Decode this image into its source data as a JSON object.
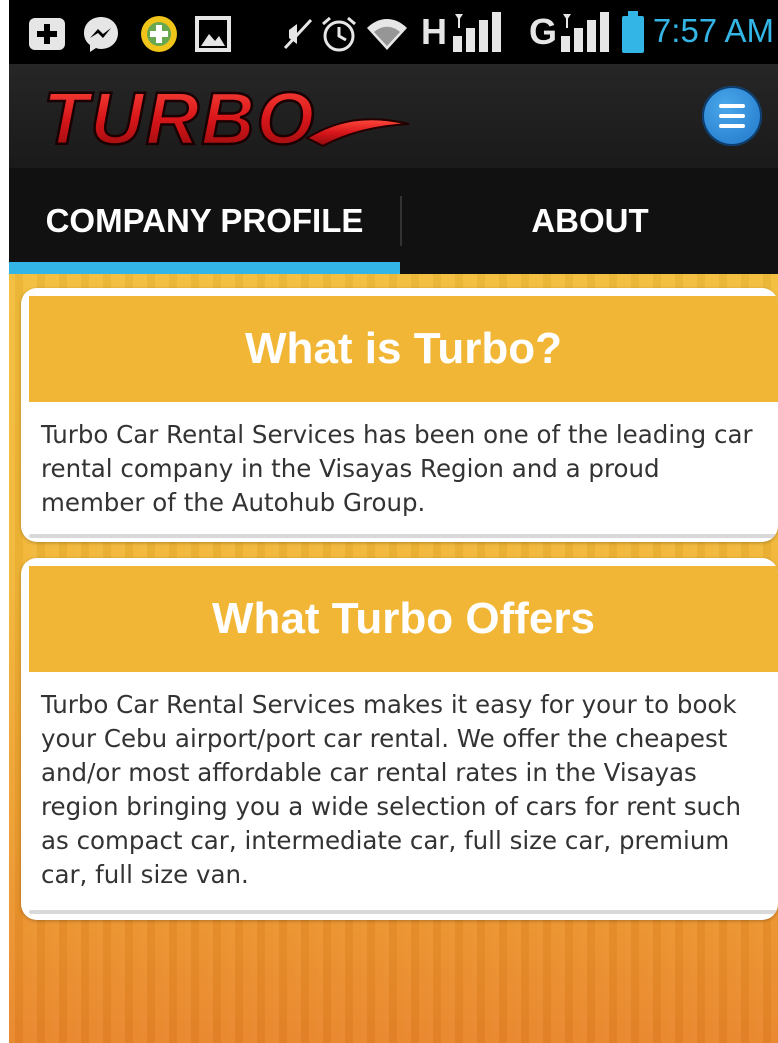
{
  "status_bar": {
    "time": "7:57 AM",
    "network_h": "H",
    "network_g": "G",
    "icons": [
      "add-icon",
      "messenger-icon",
      "app-plus-icon",
      "image-icon",
      "mute-icon",
      "alarm-icon",
      "wifi-icon",
      "signal-icon",
      "battery-icon"
    ]
  },
  "header": {
    "logo_text": "TURBO",
    "menu_icon": "hamburger-menu-icon"
  },
  "tabs": [
    {
      "label": "COMPANY PROFILE",
      "selected": true
    },
    {
      "label": "ABOUT",
      "selected": false
    }
  ],
  "cards": [
    {
      "title": "What is Turbo?",
      "body": "Turbo Car Rental Services has been one of the leading car rental company in the Visayas Region and a proud member of the Autohub Group."
    },
    {
      "title": "What Turbo Offers",
      "body": "Turbo Car Rental Services makes it easy for your to book your Cebu airport/port car rental. We offer the cheapest  and/or most affordable car rental rates in the Visayas region bringing you a wide selection of cars for rent such as compact car, intermediate car, full size car, premium car, full size van."
    }
  ],
  "colors": {
    "accent_blue": "#33b5e5",
    "card_header": "#f2b636",
    "logo_red": "#d8161a"
  }
}
